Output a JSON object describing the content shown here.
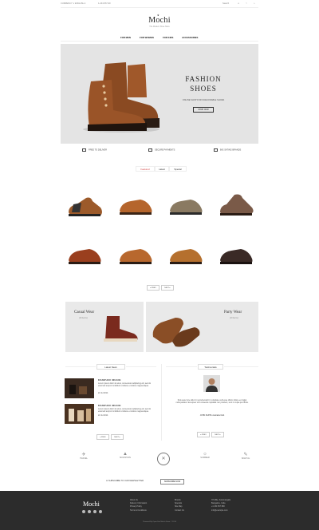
{
  "topbar": {
    "currency": "CURRENCY: ▾",
    "language": "ENGLISH ▾",
    "phone": "1-234-567-90",
    "search": "Search",
    "user": "♙",
    "wishlist": "♡",
    "cart": "⌂"
  },
  "brand": {
    "name": "Mochi",
    "tagline": "The Modern Shoe Store"
  },
  "nav": [
    "FOR MEN",
    "FOR WOMEN",
    "FOR KIDS",
    "ACCESSORIES"
  ],
  "hero": {
    "title_line1": "FASHION",
    "title_line2": "SHOES",
    "subtitle": "ONLINE SHOP FOR FASHIONABLE SHOES",
    "button": "SHOP NOW"
  },
  "features": [
    "FREE TO DELIVER",
    "SECURE PAYMENTS",
    "BIG SATING BRANDS"
  ],
  "tabs": [
    "Featured",
    "Latest",
    "Special"
  ],
  "pager": {
    "prev": "◂ PREV",
    "next": "NEXT ▸"
  },
  "promos": [
    {
      "title": "Casual Wear",
      "sub": "(10 items)"
    },
    {
      "title": "Party Wear",
      "sub": "(10 items)"
    }
  ],
  "news": {
    "title": "Latest News",
    "items": [
      {
        "head": "FAUGP ACC 400 ACE",
        "text": "Lorem ipsum dolor sit amet, consectetur adipiscing elit, sed do eiusmod tempor incididunt ut labore et dolore magna aliqua.",
        "date": "22 Jul 2014"
      },
      {
        "head": "FAUGP ACC 400 ACE",
        "text": "Lorem ipsum dolor sit amet, consectetur adipiscing elit, sed do eiusmod tempor incididunt ut labore et dolore magna aliqua.",
        "date": "22 Jul 2014"
      }
    ]
  },
  "testimonial": {
    "title": "Testimonials",
    "text": "Duis aute irure dolor in reprehenderit in voluptate velit esse cillum dolore eu fugiat nulla pariatur. Excepteur sint occaecat cupidatat non proident, sunt in culpa qui officia.",
    "author": "JOHN DUPPL Australia Club"
  },
  "brands": [
    "TRAVEL",
    "MOUNTAIN",
    "",
    "SUMMER",
    "SKETCH"
  ],
  "newsletter": {
    "text": "SUBSCRIBE TO OUR NEWSLETTER",
    "button": "SUBSCRIBE NOW"
  },
  "footer": {
    "logo": "Mochi",
    "col1": [
      "About Us",
      "Delivery Information",
      "Privacy Policy",
      "Terms & Conditions"
    ],
    "col2": [
      "Brands",
      "Specials",
      "Site Map",
      "Contact Us"
    ],
    "col3": [
      "7th Mile, Koramangala",
      "Bangalore, India",
      "+1 234 567 890",
      "info@example.com"
    ],
    "copyright": "Powered By OpenCart Mochi Store © 2014"
  },
  "colors": {
    "accent": "#d24545",
    "footer_bg": "#2c2c2c",
    "hero_bg": "#e4e4e4"
  }
}
